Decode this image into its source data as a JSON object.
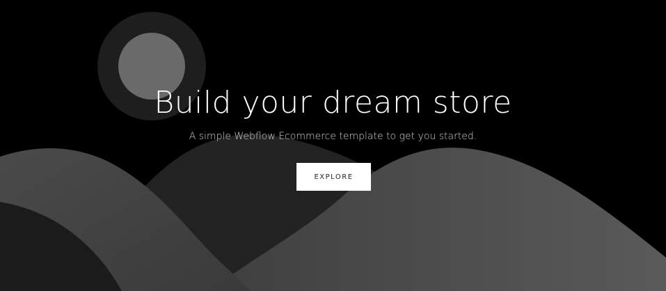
{
  "hero": {
    "title": "Build your dream store",
    "subtitle": "A simple Webflow Ecommerce template to get you started.",
    "cta_label": "EXPLORE"
  },
  "colors": {
    "background": "#000000",
    "button_background": "#ffffff",
    "button_text": "#222222",
    "title_text": "#ffffff",
    "subtitle_text": "#cfcfcf"
  }
}
